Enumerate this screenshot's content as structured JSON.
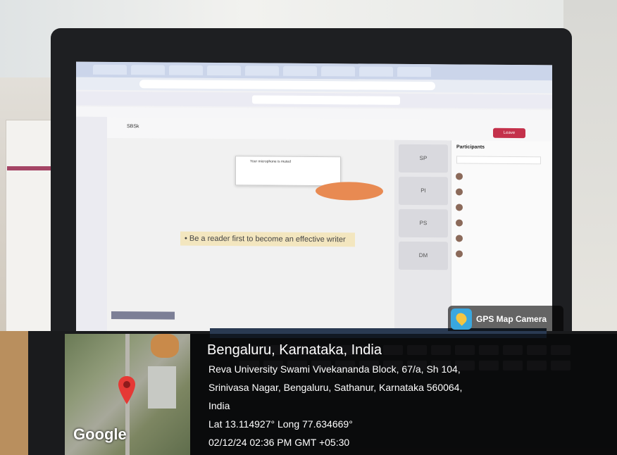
{
  "screen": {
    "tabs": [
      "",
      "",
      "",
      "",
      "",
      "",
      "",
      "",
      ""
    ],
    "meeting_title": "SBSk",
    "leave_label": "Leave",
    "participants_title": "Participants",
    "quote": "• Be a reader first to become an effective writer",
    "mic_toast": "Your microphone is muted",
    "thumbnails": [
      "SP",
      "PI",
      "PS",
      "DM"
    ],
    "participants": [
      "",
      "",
      "",
      "",
      "",
      ""
    ]
  },
  "overlay": {
    "badge_text": "GPS Map Camera",
    "location_title": "Bengaluru, Karnataka, India",
    "address_line1": "Reva University Swami Vivekananda Block, 67/a, Sh 104,",
    "address_line2": "Srinivasa Nagar, Bengaluru, Sathanur, Karnataka 560064,",
    "address_line3": "India",
    "coordinates": "Lat 13.114927° Long 77.634669°",
    "datetime": "02/12/24 02:36 PM GMT +05:30",
    "map_logo": "Google"
  },
  "colors": {
    "leave_button": "#c4314b",
    "quote_highlight": "#f3e6bf",
    "pin": "#e53935"
  }
}
